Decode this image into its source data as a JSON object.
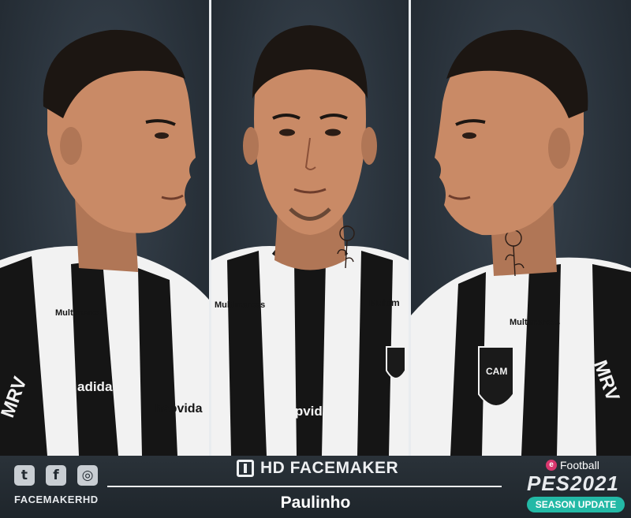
{
  "social": {
    "icons": [
      "twitter-icon",
      "facebook-icon",
      "instagram-icon"
    ],
    "twitter_glyph": "t",
    "facebook_glyph": "f",
    "instagram_glyph": "◎",
    "handle": "FACEMAKERHD"
  },
  "brand": {
    "name": "HD FACEMAKER"
  },
  "player": {
    "name": "Paulinho"
  },
  "game": {
    "publisher_line": "Football",
    "title": "PES2021",
    "edition": "SEASON UPDATE"
  },
  "shirt": {
    "sponsor_left": "Multimarcas",
    "sponsor_right": "Multim",
    "main_sponsor": "hapvida",
    "kit_brand": "adidas",
    "sleeve_text": "MRV",
    "crest_text": "CAM"
  },
  "colors": {
    "background": "#222a31",
    "divider": "#e9ecef",
    "season_badge": "#23b9a6",
    "efootball_badge": "#d9376e"
  }
}
